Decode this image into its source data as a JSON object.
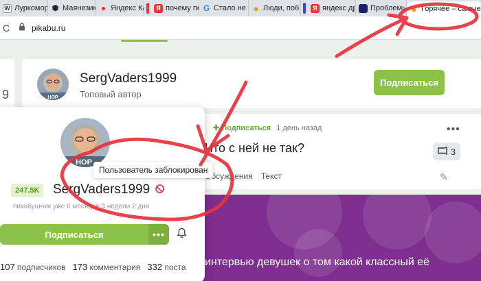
{
  "colors": {
    "accent_green": "#8bc34a",
    "ban_red": "#e05050",
    "promo_purple": "#7e2e8f",
    "scribble_red": "#e8323c"
  },
  "tabs": [
    {
      "label": "Луркомор",
      "icon": "wikipedia-icon",
      "fav": "W",
      "color": "#555555"
    },
    {
      "label": "Маянезик",
      "icon": "openai-icon",
      "fav": "✺",
      "color": "#222222"
    },
    {
      "label": "Яндекс Кар",
      "icon": "map-pin-icon",
      "fav": "●",
      "color": "#e53935"
    },
    {
      "label": "почему пе",
      "icon": "yandex-icon",
      "fav": "Я",
      "color": "#e53935"
    },
    {
      "label": "Стало не в",
      "icon": "google-icon",
      "fav": "G",
      "color": "#4285f4"
    },
    {
      "label": "Люди, поб",
      "icon": "pikabu-icon",
      "fav": "●",
      "color": "#e8962b"
    },
    {
      "label": "яндекс дра",
      "icon": "yandex-icon",
      "fav": "Я",
      "color": "#e53935"
    },
    {
      "label": "Проблемы",
      "icon": "blue-app-icon",
      "fav": "●",
      "color": "#3948d6"
    },
    {
      "label": "Горячее – самые и",
      "icon": "pikabu-icon",
      "fav": "●",
      "color": "#e8962b"
    }
  ],
  "address": {
    "url": "pikabu.ru"
  },
  "left_card": {
    "number": "9"
  },
  "author": {
    "name": "SergVaders1999",
    "subtitle": "Топовый автор",
    "subscribe": "Подписаться",
    "avatar_caption": "НОР"
  },
  "post": {
    "subscribe": "Подписаться",
    "time": "1 день назад",
    "title": "Что с ней не так?",
    "comments": "3",
    "tag_discussion": "Обсуждения",
    "tag_text": "Текст"
  },
  "promo": {
    "text": "интервью девушек о том какой классный её"
  },
  "popup": {
    "avatar_caption": "НОР",
    "tooltip": "Пользователь заблокирован",
    "rating": "247.5K",
    "name": "SergVaders1999",
    "since": "пикабушник уже 6 месяцев 3 недели 2 дня",
    "subscribe": "Подписаться",
    "stats": {
      "subscribers_count": "107",
      "subscribers_label": "подписчиков",
      "comments_count": "173",
      "comments_label": "комментария",
      "posts_count": "332",
      "posts_label": "поста"
    }
  }
}
